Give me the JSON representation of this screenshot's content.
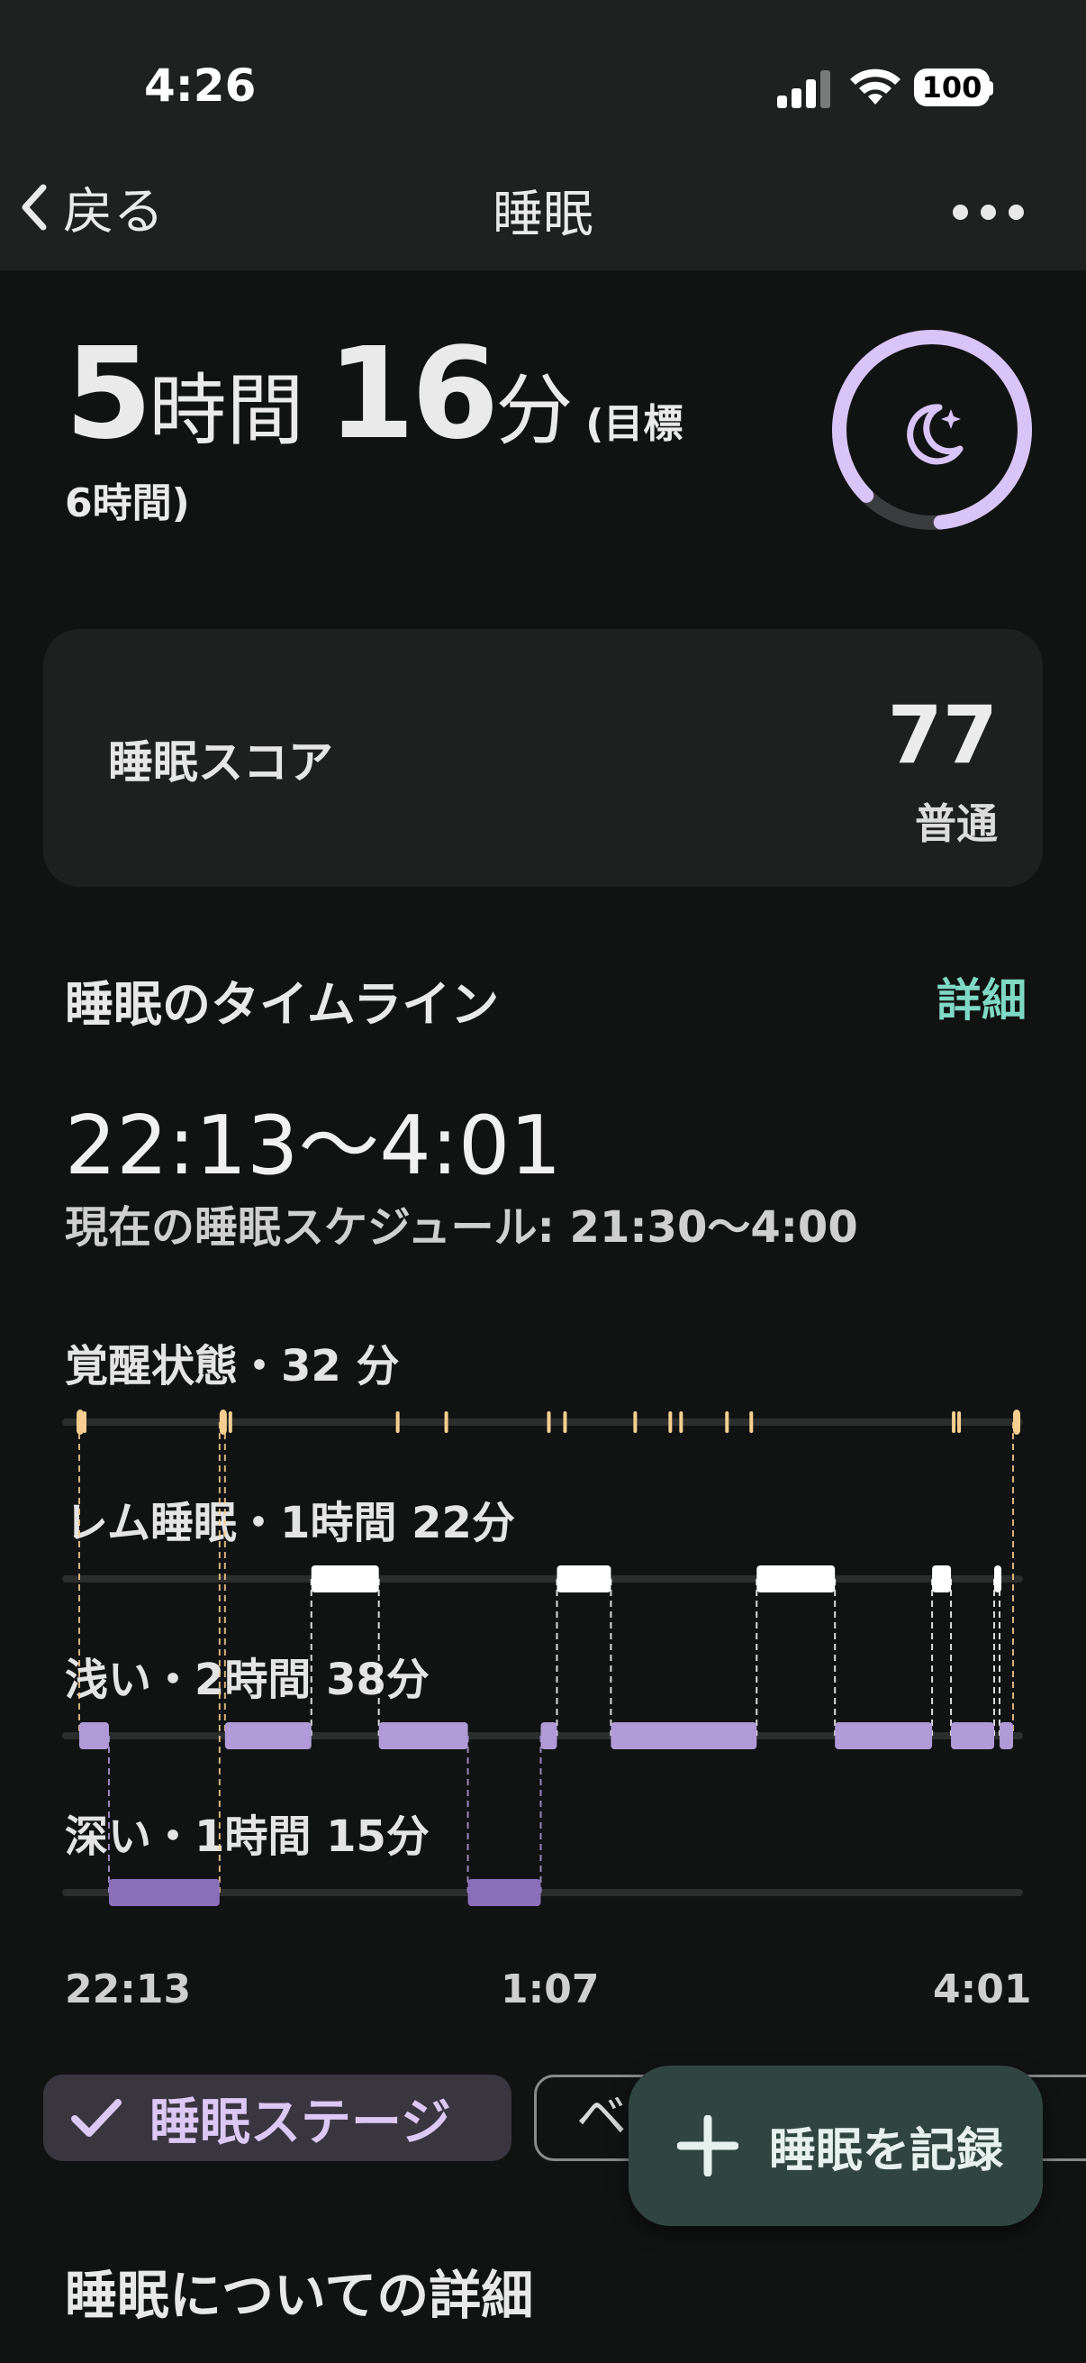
{
  "status_bar": {
    "time": "4:26",
    "battery": "100"
  },
  "nav": {
    "back_label": "戻る",
    "title": "睡眠"
  },
  "summary": {
    "hours": "5",
    "hours_unit": "時間",
    "minutes": "16",
    "minutes_unit": "分",
    "goal_prefix": "(目標",
    "goal_suffix": "6時間)",
    "goal_ring_fraction": 0.86
  },
  "score": {
    "label": "睡眠スコア",
    "value": "77",
    "rating": "普通"
  },
  "timeline": {
    "title": "睡眠のタイムライン",
    "detail_link": "詳細",
    "range": "22:13〜4:01",
    "schedule": "現在の睡眠スケジュール: 21:30〜4:00",
    "stages": {
      "awake": "覚醒状態・32 分",
      "rem": "レム睡眠・1時間 22分",
      "light": "浅い・2時間 38分",
      "deep": "深い・1時間 15分"
    },
    "axis": {
      "start": "22:13",
      "mid": "1:07",
      "end": "4:01"
    }
  },
  "chart_data": {
    "type": "timeline",
    "x_range": [
      "22:13",
      "4:01"
    ],
    "stages": [
      "awake",
      "rem",
      "light",
      "deep"
    ],
    "segments": [
      {
        "stage": "awake",
        "start": "22:13",
        "end": "22:14"
      },
      {
        "stage": "light",
        "start": "22:14",
        "end": "22:25"
      },
      {
        "stage": "deep",
        "start": "22:25",
        "end": "23:06"
      },
      {
        "stage": "awake",
        "start": "23:06",
        "end": "23:08"
      },
      {
        "stage": "light",
        "start": "23:08",
        "end": "23:40"
      },
      {
        "stage": "rem",
        "start": "23:40",
        "end": "0:05"
      },
      {
        "stage": "light",
        "start": "0:05",
        "end": "0:38"
      },
      {
        "stage": "deep",
        "start": "0:38",
        "end": "1:05"
      },
      {
        "stage": "light",
        "start": "1:05",
        "end": "1:11"
      },
      {
        "stage": "rem",
        "start": "1:11",
        "end": "1:31"
      },
      {
        "stage": "light",
        "start": "1:31",
        "end": "2:25"
      },
      {
        "stage": "rem",
        "start": "2:25",
        "end": "2:54"
      },
      {
        "stage": "light",
        "start": "2:54",
        "end": "3:30"
      },
      {
        "stage": "rem",
        "start": "3:30",
        "end": "3:37"
      },
      {
        "stage": "light",
        "start": "3:37",
        "end": "3:53"
      },
      {
        "stage": "rem",
        "start": "3:53",
        "end": "3:55"
      },
      {
        "stage": "light",
        "start": "3:55",
        "end": "4:00"
      },
      {
        "stage": "awake",
        "start": "4:00",
        "end": "4:01"
      }
    ],
    "awake_ticks": [
      "22:16",
      "23:10",
      "0:12",
      "0:30",
      "1:08",
      "1:14",
      "1:40",
      "1:53",
      "1:57",
      "2:14",
      "2:23",
      "3:38",
      "3:40"
    ]
  },
  "chips": {
    "stage": "睡眠ステージ",
    "second": "ベ"
  },
  "fab": {
    "label": "睡眠を記録"
  },
  "details": {
    "title": "睡眠についての詳細"
  },
  "colors": {
    "awake": "#f6cf90",
    "rem": "#ffffff",
    "light": "#b19ad8",
    "deep": "#8a6fba",
    "accent": "#d8c4f7",
    "link": "#7fd9c4"
  }
}
